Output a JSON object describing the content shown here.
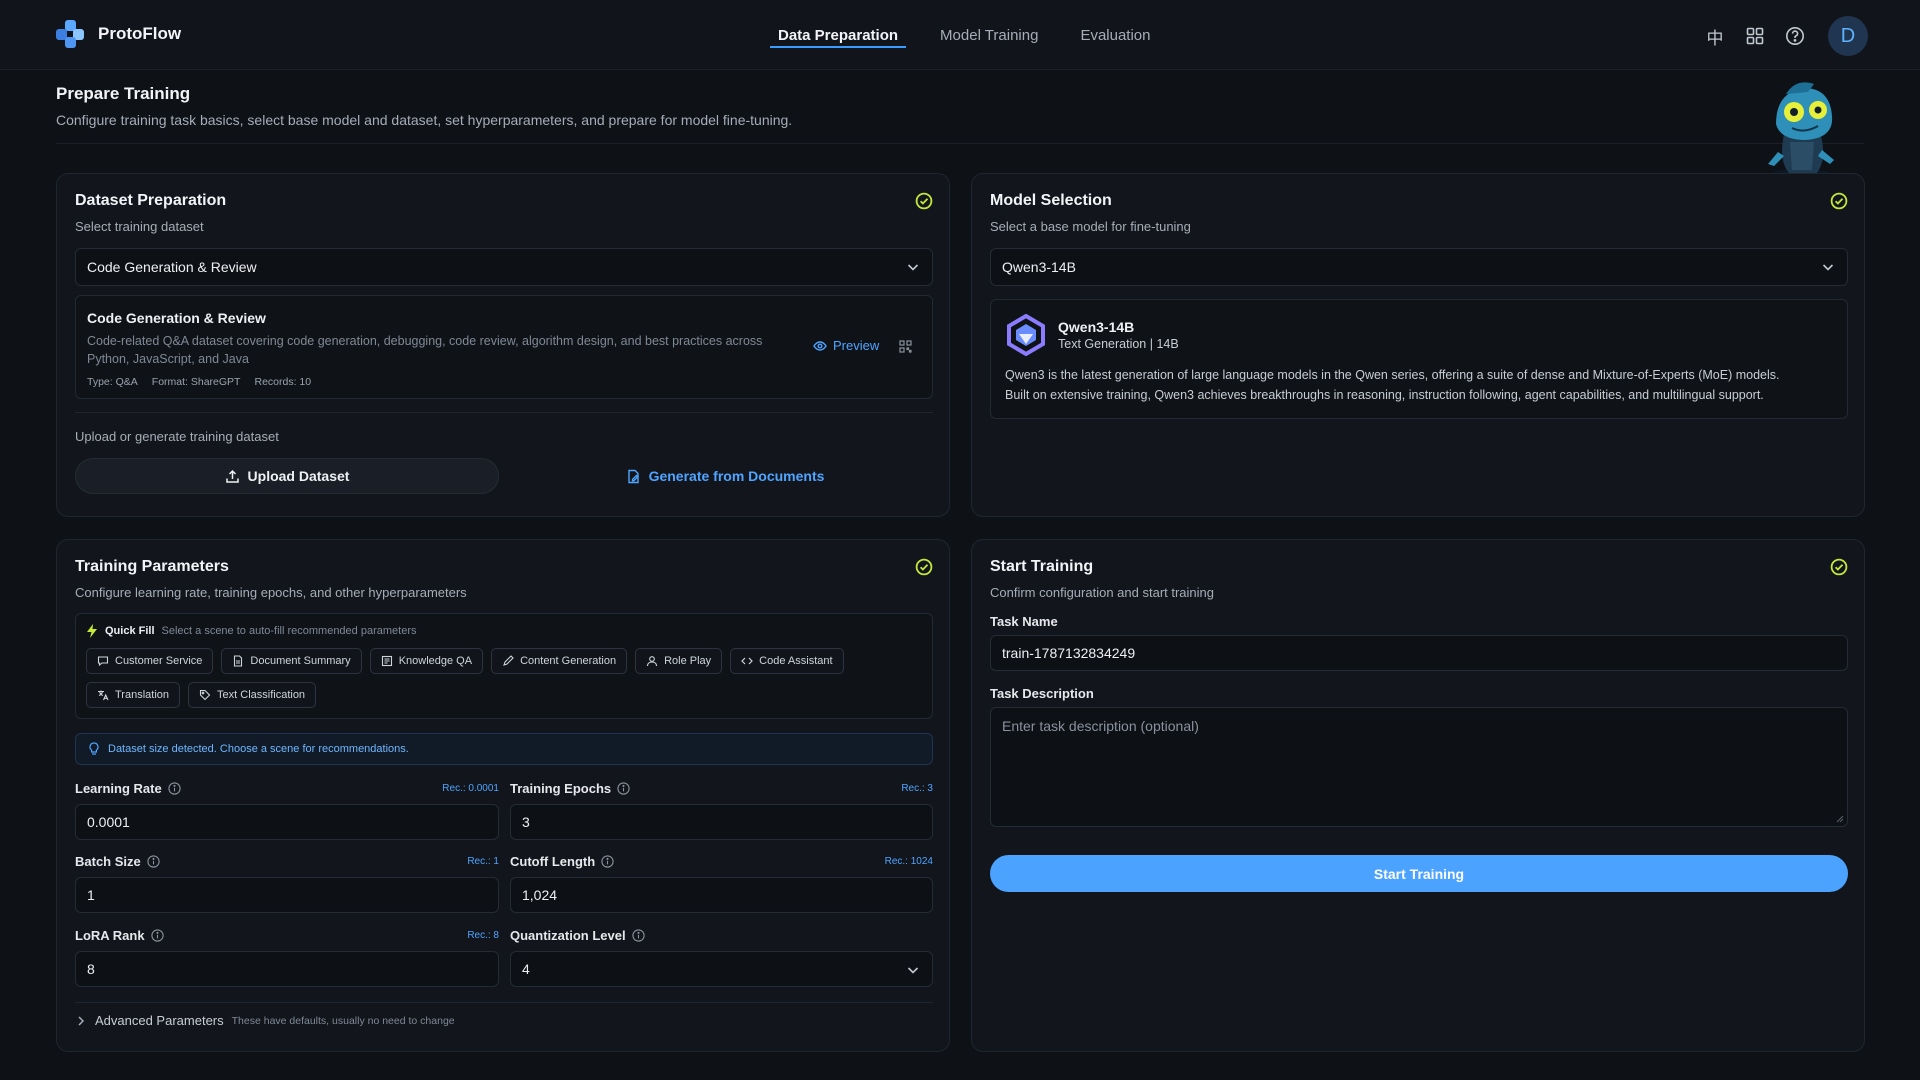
{
  "app": {
    "name": "ProtoFlow",
    "avatar_letter": "D"
  },
  "nav": {
    "tabs": [
      {
        "label": "Data Preparation"
      },
      {
        "label": "Model Training"
      },
      {
        "label": "Evaluation"
      }
    ]
  },
  "top_icons": {
    "lang": "中"
  },
  "page": {
    "title": "Prepare Training",
    "subtitle": "Configure training task basics, select base model and dataset, set hyperparameters, and prepare for model fine-tuning."
  },
  "dataset": {
    "title": "Dataset Preparation",
    "subtitle": "Select training dataset",
    "selected": "Code Generation & Review",
    "info_title": "Code Generation & Review",
    "info_desc": "Code-related Q&A dataset covering code generation, debugging, code review, algorithm design, and best practices across Python, JavaScript, and Java",
    "meta_type": "Type: Q&A",
    "meta_format": "Format: ShareGPT",
    "meta_records": "Records: 10",
    "preview_label": "Preview",
    "upload_section_label": "Upload or generate training dataset",
    "upload_button": "Upload Dataset",
    "generate_button": "Generate from Documents"
  },
  "model": {
    "title": "Model Selection",
    "subtitle": "Select a base model for fine-tuning",
    "selected": "Qwen3-14B",
    "card_name": "Qwen3-14B",
    "card_meta": "Text Generation | 14B",
    "card_desc_1": "Qwen3 is the latest generation of large language models in the Qwen series, offering a suite of dense and Mixture-of-Experts (MoE) models.",
    "card_desc_2": "Built on extensive training, Qwen3 achieves breakthroughs in reasoning, instruction following, agent capabilities, and multilingual support."
  },
  "params": {
    "title": "Training Parameters",
    "subtitle": "Configure learning rate, training epochs, and other hyperparameters",
    "quick_fill_label": "Quick Fill",
    "quick_fill_hint": "Select a scene to auto-fill recommended parameters",
    "scenes": [
      {
        "label": "Customer Service",
        "icon": "chat-icon"
      },
      {
        "label": "Document Summary",
        "icon": "document-icon"
      },
      {
        "label": "Knowledge QA",
        "icon": "book-icon"
      },
      {
        "label": "Content Generation",
        "icon": "pen-icon"
      },
      {
        "label": "Role Play",
        "icon": "user-icon"
      },
      {
        "label": "Code Assistant",
        "icon": "code-icon"
      },
      {
        "label": "Translation",
        "icon": "translate-icon"
      },
      {
        "label": "Text Classification",
        "icon": "tag-icon"
      }
    ],
    "notice": "Dataset size detected. Choose a scene for recommendations.",
    "learning_rate": {
      "label": "Learning Rate",
      "rec": "Rec.: 0.0001",
      "value": "0.0001"
    },
    "training_epochs": {
      "label": "Training Epochs",
      "rec": "Rec.: 3",
      "value": "3"
    },
    "batch_size": {
      "label": "Batch Size",
      "rec": "Rec.: 1",
      "value": "1"
    },
    "cutoff_length": {
      "label": "Cutoff Length",
      "rec": "Rec.: 1024",
      "value": "1,024"
    },
    "lora_rank": {
      "label": "LoRA Rank",
      "rec": "Rec.: 8",
      "value": "8"
    },
    "quantization_level": {
      "label": "Quantization Level",
      "value": "4"
    },
    "advanced_label": "Advanced Parameters",
    "advanced_hint": "These have defaults, usually no need to change"
  },
  "start": {
    "title": "Start Training",
    "subtitle": "Confirm configuration and start training",
    "task_name_label": "Task Name",
    "task_name_value": "train-1787132834249",
    "task_desc_label": "Task Description",
    "task_desc_placeholder": "Enter task description (optional)",
    "button": "Start Training"
  },
  "colors": {
    "accent": "#4ba3ff",
    "check": "#c6e83a",
    "background": "#0e1116",
    "card": "#12161c"
  }
}
